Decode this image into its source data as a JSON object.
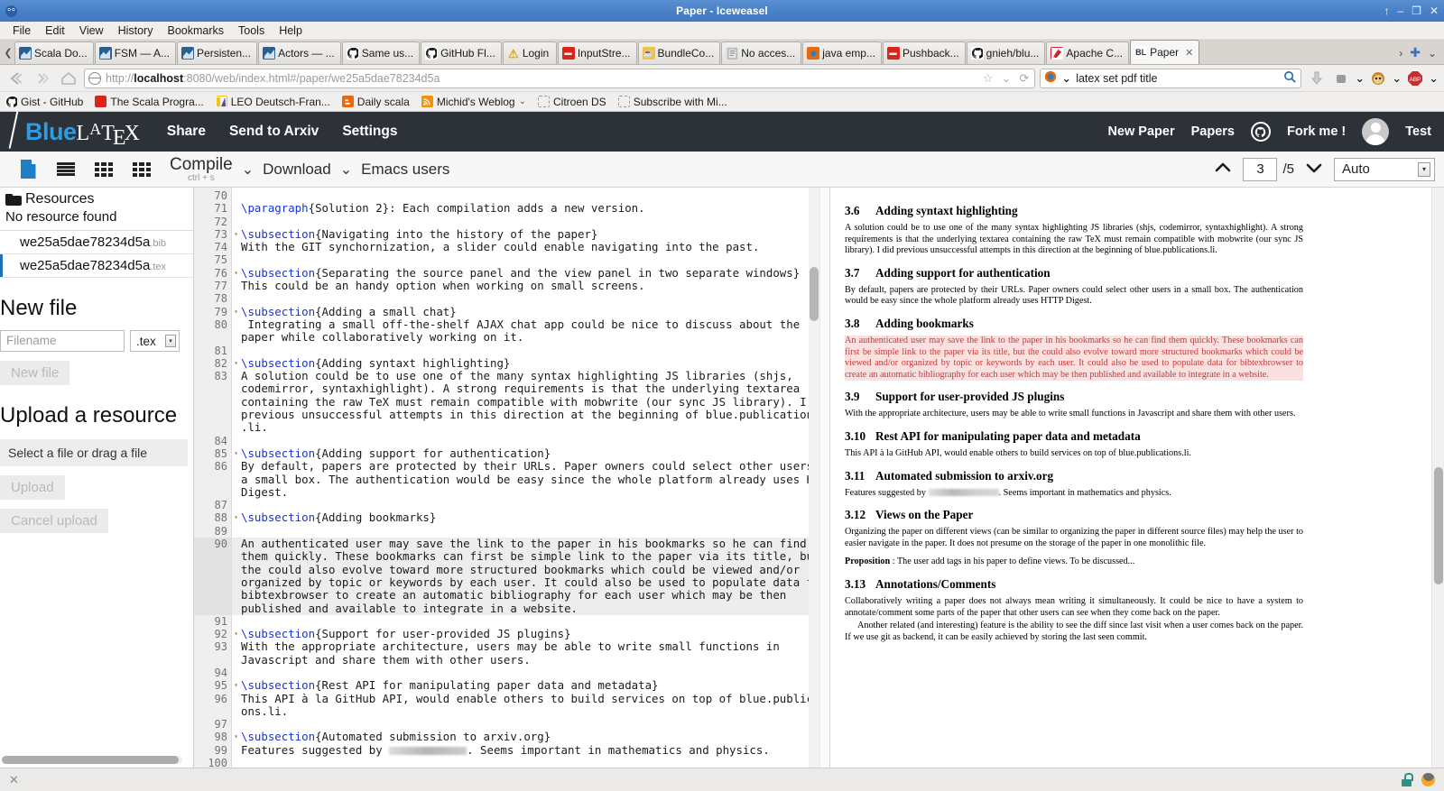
{
  "window": {
    "title": "Paper - Iceweasel",
    "buttons": [
      "↑",
      "–",
      "❐",
      "✕"
    ]
  },
  "menubar": [
    "File",
    "Edit",
    "View",
    "History",
    "Bookmarks",
    "Tools",
    "Help"
  ],
  "tabs": [
    {
      "label": "Scala Do...",
      "icon": "scala-icon",
      "kind": "scala",
      "active": false
    },
    {
      "label": "FSM — A...",
      "icon": "scala-icon",
      "kind": "scala",
      "active": false
    },
    {
      "label": "Persisten...",
      "icon": "scala-icon",
      "kind": "scala",
      "active": false
    },
    {
      "label": "Actors — ...",
      "icon": "scala-icon",
      "kind": "scala",
      "active": false
    },
    {
      "label": "Same us...",
      "icon": "github-icon",
      "kind": "github",
      "active": false
    },
    {
      "label": "GitHub Fl...",
      "icon": "github-icon",
      "kind": "github",
      "active": false
    },
    {
      "label": "Login",
      "icon": "warning-icon",
      "kind": "warn",
      "active": false
    },
    {
      "label": "InputStre...",
      "icon": "stackoverflow-icon",
      "kind": "red",
      "active": false
    },
    {
      "label": "BundleCo...",
      "icon": "bundle-icon",
      "kind": "bundle",
      "active": false
    },
    {
      "label": "No acces...",
      "icon": "document-icon",
      "kind": "doc",
      "active": false
    },
    {
      "label": "java emp...",
      "icon": "firefox-icon",
      "kind": "ff",
      "active": false
    },
    {
      "label": "Pushback...",
      "icon": "stackoverflow-icon",
      "kind": "red",
      "active": false
    },
    {
      "label": "gnieh/blu...",
      "icon": "github-icon",
      "kind": "github",
      "active": false
    },
    {
      "label": "Apache C...",
      "icon": "apache-icon",
      "kind": "apache",
      "active": false
    },
    {
      "label": "Paper",
      "icon": "bluelatex-icon",
      "kind": "bl",
      "active": true
    }
  ],
  "tab_close_label": "✕",
  "tab_overflow_label": "›",
  "tab_new_label": "✚",
  "tab_list_label": "⌄",
  "navbar": {
    "back_icon": "back-arrow-icon",
    "forward_icon": "forward-arrow-icon",
    "home_icon": "home-icon",
    "url": "http://localhost:8080/web/index.html#/paper/we25a5dae78234d5a",
    "url_host": "localhost",
    "url_prefix": "http://",
    "url_suffix": ":8080/web/index.html#/paper/we25a5dae78234d5a",
    "bookmark_star": "☆",
    "reload_icon": "reload-icon",
    "search_query": "latex set pdf title",
    "search_engine_icon": "firefox-icon",
    "search_go_icon": "search-icon",
    "downloads_icon": "download-arrow-icon",
    "extensions_icon": "puzzle-icon",
    "account_icon": "monkey-icon",
    "adblock_icon": "adblock-icon"
  },
  "bookmarks": [
    {
      "label": "Gist - GitHub",
      "icon": "github-icon",
      "kind": "github"
    },
    {
      "label": "The Scala Progra...",
      "icon": "scala-icon",
      "kind": "scalared"
    },
    {
      "label": "LEO Deutsch-Fran...",
      "icon": "leo-icon",
      "kind": "leo"
    },
    {
      "label": "Daily scala",
      "icon": "blogger-icon",
      "kind": "blogger"
    },
    {
      "label": "Michid's Weblog",
      "icon": "rss-icon",
      "kind": "rss",
      "chevron": "⌄"
    },
    {
      "label": "Citroen DS",
      "icon": "placeholder-icon",
      "kind": "dashed"
    },
    {
      "label": "Subscribe with Mi...",
      "icon": "placeholder-icon",
      "kind": "dashed"
    }
  ],
  "app": {
    "logo": {
      "blue": "Blue",
      "l": "L",
      "a": "A",
      "t": "T",
      "e": "E",
      "x": "X"
    },
    "nav": [
      "Share",
      "Send to Arxiv",
      "Settings"
    ],
    "right_nav": [
      "New Paper",
      "Papers"
    ],
    "github_icon": "github-icon",
    "fork_label": "Fork me !",
    "avatar_icon": "avatar-icon",
    "user": "Test"
  },
  "toolbar": {
    "icons": [
      "document-icon",
      "rows-icon",
      "grid-icon",
      "grid-large-icon"
    ],
    "compile_label": "Compile",
    "compile_shortcut": "ctrl + s",
    "chevron": "⌄",
    "download_label": "Download",
    "emacs_label": "Emacs users",
    "page_up_icon": "chevron-up-icon",
    "page_current": "3",
    "page_total": "/5",
    "page_down_icon": "chevron-down-icon",
    "zoom_value": "Auto",
    "zoom_arrow": "▾"
  },
  "sidebar": {
    "resources_title": "Resources",
    "resources_empty": "No resource found",
    "files": [
      {
        "name": "we25a5dae78234d5a",
        "ext": ".bib",
        "active": false
      },
      {
        "name": "we25a5dae78234d5a",
        "ext": ".tex",
        "active": true
      }
    ],
    "new_file_title": "New file",
    "filename_placeholder": "Filename",
    "ext_value": ".tex",
    "new_file_button": "New file",
    "upload_title": "Upload a resource",
    "dropzone_label": "Select a file or drag a file",
    "upload_button": "Upload",
    "cancel_button": "Cancel upload"
  },
  "editor": {
    "lines": [
      {
        "n": "70",
        "fold": false,
        "hl": false,
        "segs": [
          {
            "t": "",
            "c": false
          }
        ]
      },
      {
        "n": "71",
        "fold": false,
        "hl": false,
        "segs": [
          {
            "t": "\\paragraph",
            "c": true
          },
          {
            "t": "{Solution 2}: Each compilation adds a new version.",
            "c": false
          }
        ]
      },
      {
        "n": "72",
        "fold": false,
        "hl": false,
        "segs": [
          {
            "t": "",
            "c": false
          }
        ]
      },
      {
        "n": "73",
        "fold": true,
        "hl": false,
        "segs": [
          {
            "t": "\\subsection",
            "c": true
          },
          {
            "t": "{Navigating into the history of the paper}",
            "c": false
          }
        ]
      },
      {
        "n": "74",
        "fold": false,
        "hl": false,
        "segs": [
          {
            "t": "With the GIT synchornization, a slider could enable navigating into the past.",
            "c": false
          }
        ]
      },
      {
        "n": "75",
        "fold": false,
        "hl": false,
        "segs": [
          {
            "t": "",
            "c": false
          }
        ]
      },
      {
        "n": "76",
        "fold": true,
        "hl": false,
        "segs": [
          {
            "t": "\\subsection",
            "c": true
          },
          {
            "t": "{Separating the source panel and the view panel in two separate windows}",
            "c": false
          }
        ]
      },
      {
        "n": "77",
        "fold": false,
        "hl": false,
        "segs": [
          {
            "t": "This could be an handy option when working on small screens.",
            "c": false
          }
        ]
      },
      {
        "n": "78",
        "fold": false,
        "hl": false,
        "segs": [
          {
            "t": "",
            "c": false
          }
        ]
      },
      {
        "n": "79",
        "fold": true,
        "hl": false,
        "segs": [
          {
            "t": "\\subsection",
            "c": true
          },
          {
            "t": "{Adding a small chat}",
            "c": false
          }
        ]
      },
      {
        "n": "80",
        "fold": false,
        "hl": false,
        "segs": [
          {
            "t": " Integrating a small off-the-shelf AJAX chat app could be nice to discuss about the",
            "c": false
          }
        ]
      },
      {
        "n": "",
        "fold": false,
        "hl": false,
        "segs": [
          {
            "t": "paper while collaboratively working on it.",
            "c": false
          }
        ]
      },
      {
        "n": "81",
        "fold": false,
        "hl": false,
        "segs": [
          {
            "t": "",
            "c": false
          }
        ]
      },
      {
        "n": "82",
        "fold": true,
        "hl": false,
        "segs": [
          {
            "t": "\\subsection",
            "c": true
          },
          {
            "t": "{Adding syntaxt highlighting}",
            "c": false
          }
        ]
      },
      {
        "n": "83",
        "fold": false,
        "hl": false,
        "segs": [
          {
            "t": "A solution could be to use one of the many syntax highlighting JS libraries (shjs,",
            "c": false
          }
        ]
      },
      {
        "n": "",
        "fold": false,
        "hl": false,
        "segs": [
          {
            "t": "codemirror, syntaxhighlight). A strong requirements is that the underlying textarea",
            "c": false
          }
        ]
      },
      {
        "n": "",
        "fold": false,
        "hl": false,
        "segs": [
          {
            "t": "containing the raw TeX must remain compatible with mobwrite (our sync JS library). I did",
            "c": false
          }
        ]
      },
      {
        "n": "",
        "fold": false,
        "hl": false,
        "segs": [
          {
            "t": "previous unsuccessful attempts in this direction at the beginning of blue.publications",
            "c": false
          }
        ]
      },
      {
        "n": "",
        "fold": false,
        "hl": false,
        "segs": [
          {
            "t": ".li.",
            "c": false
          }
        ]
      },
      {
        "n": "84",
        "fold": false,
        "hl": false,
        "segs": [
          {
            "t": "",
            "c": false
          }
        ]
      },
      {
        "n": "85",
        "fold": true,
        "hl": false,
        "segs": [
          {
            "t": "\\subsection",
            "c": true
          },
          {
            "t": "{Adding support for authentication}",
            "c": false
          }
        ]
      },
      {
        "n": "86",
        "fold": false,
        "hl": false,
        "segs": [
          {
            "t": "By default, papers are protected by their URLs. Paper owners could select other users in",
            "c": false
          }
        ]
      },
      {
        "n": "",
        "fold": false,
        "hl": false,
        "segs": [
          {
            "t": "a small box. The authentication would be easy since the whole platform already uses HTTP",
            "c": false
          }
        ]
      },
      {
        "n": "",
        "fold": false,
        "hl": false,
        "segs": [
          {
            "t": "Digest.",
            "c": false
          }
        ]
      },
      {
        "n": "87",
        "fold": false,
        "hl": false,
        "segs": [
          {
            "t": "",
            "c": false
          }
        ]
      },
      {
        "n": "88",
        "fold": true,
        "hl": false,
        "segs": [
          {
            "t": "\\subsection",
            "c": true
          },
          {
            "t": "{Adding bookmarks}",
            "c": false
          }
        ]
      },
      {
        "n": "89",
        "fold": false,
        "hl": false,
        "segs": [
          {
            "t": "",
            "c": false
          }
        ]
      },
      {
        "n": "90",
        "fold": false,
        "hl": true,
        "segs": [
          {
            "t": "An authenticated user may save the link to the paper in his bookmarks so he can find",
            "c": false
          }
        ]
      },
      {
        "n": "",
        "fold": false,
        "hl": true,
        "segs": [
          {
            "t": "them quickly. These bookmarks can first be simple link to the paper via its title, but",
            "c": false
          }
        ]
      },
      {
        "n": "",
        "fold": false,
        "hl": true,
        "segs": [
          {
            "t": "the could also evolve toward more structured bookmarks which could be viewed and/or",
            "c": false
          }
        ]
      },
      {
        "n": "",
        "fold": false,
        "hl": true,
        "segs": [
          {
            "t": "organized by topic or keywords by each user. It could also be used to populate data for",
            "c": false
          }
        ]
      },
      {
        "n": "",
        "fold": false,
        "hl": true,
        "segs": [
          {
            "t": "bibtexbrowser to create an automatic bibliography for each user which may be then",
            "c": false
          }
        ]
      },
      {
        "n": "",
        "fold": false,
        "hl": true,
        "segs": [
          {
            "t": "published and available to integrate in a website.",
            "c": false
          }
        ]
      },
      {
        "n": "91",
        "fold": false,
        "hl": false,
        "segs": [
          {
            "t": "",
            "c": false
          }
        ]
      },
      {
        "n": "92",
        "fold": true,
        "hl": false,
        "segs": [
          {
            "t": "\\subsection",
            "c": true
          },
          {
            "t": "{Support for user-provided JS plugins}",
            "c": false
          }
        ]
      },
      {
        "n": "93",
        "fold": false,
        "hl": false,
        "segs": [
          {
            "t": "With the appropriate architecture, users may be able to write small functions in",
            "c": false
          }
        ]
      },
      {
        "n": "",
        "fold": false,
        "hl": false,
        "segs": [
          {
            "t": "Javascript and share them with other users.",
            "c": false
          }
        ]
      },
      {
        "n": "94",
        "fold": false,
        "hl": false,
        "segs": [
          {
            "t": "",
            "c": false
          }
        ]
      },
      {
        "n": "95",
        "fold": true,
        "hl": false,
        "segs": [
          {
            "t": "\\subsection",
            "c": true
          },
          {
            "t": "{Rest API for manipulating paper data and metadata}",
            "c": false
          }
        ]
      },
      {
        "n": "96",
        "fold": false,
        "hl": false,
        "segs": [
          {
            "t": "This API à la GitHub API, would enable others to build services on top of blue.publicati",
            "c": false
          }
        ]
      },
      {
        "n": "",
        "fold": false,
        "hl": false,
        "segs": [
          {
            "t": "ons.li.",
            "c": false
          }
        ]
      },
      {
        "n": "97",
        "fold": false,
        "hl": false,
        "segs": [
          {
            "t": "",
            "c": false
          }
        ]
      },
      {
        "n": "98",
        "fold": true,
        "hl": false,
        "segs": [
          {
            "t": "\\subsection",
            "c": true
          },
          {
            "t": "{Automated submission to arxiv.org}",
            "c": false
          }
        ]
      },
      {
        "n": "99",
        "fold": false,
        "hl": false,
        "segs": [
          {
            "t": "Features suggested by ██████████. Seems important in mathematics and physics.",
            "c": false
          }
        ]
      },
      {
        "n": "100",
        "fold": false,
        "hl": false,
        "segs": [
          {
            "t": "",
            "c": false
          }
        ]
      }
    ]
  },
  "preview": {
    "blocks": [
      {
        "type": "h",
        "num": "3.6",
        "text": "Adding syntaxt highlighting"
      },
      {
        "type": "p",
        "hl": false,
        "text": "A solution could be to use one of the many syntax highlighting JS libraries (shjs, codemirror, syntaxhighlight). A strong requirements is that the underlying textarea containing the raw TeX must remain compatible with mobwrite (our sync JS library). I did previous unsuccessful attempts in this direction at the beginning of blue.publications.li."
      },
      {
        "type": "h",
        "num": "3.7",
        "text": "Adding support for authentication"
      },
      {
        "type": "p",
        "hl": false,
        "text": "By default, papers are protected by their URLs. Paper owners could select other users in a small box. The authentication would be easy since the whole platform already uses HTTP Digest."
      },
      {
        "type": "h",
        "num": "3.8",
        "text": "Adding bookmarks"
      },
      {
        "type": "p",
        "hl": true,
        "text": "An authenticated user may save the link to the paper in his bookmarks so he can find them quickly. These bookmarks can first be simple link to the paper via its title, but the could also evolve toward more structured bookmarks which could be viewed and/or organized by topic or keywords by each user. It could also be used to populate data for bibtexbrowser to create an automatic bibliography for each user which may be then published and available to integrate in a website."
      },
      {
        "type": "h",
        "num": "3.9",
        "text": "Support for user-provided JS plugins"
      },
      {
        "type": "p",
        "hl": false,
        "text": "With the appropriate architecture, users may be able to write small functions in Javascript and share them with other users."
      },
      {
        "type": "h",
        "num": "3.10",
        "text": "Rest API for manipulating paper data and metadata"
      },
      {
        "type": "p",
        "hl": false,
        "text": "This API à la GitHub API, would enable others to build services on top of blue.publications.li."
      },
      {
        "type": "h",
        "num": "3.11",
        "text": "Automated submission to arxiv.org"
      },
      {
        "type": "redacted",
        "hl": false,
        "pre": "Features suggested by ",
        "post": ". Seems important in mathematics and physics."
      },
      {
        "type": "h",
        "num": "3.12",
        "text": "Views on the Paper"
      },
      {
        "type": "p",
        "hl": false,
        "text": "Organizing the paper on different views (can be similar to organizing the paper in different source files) may help the user to easier navigate in the paper. It does not presume on the storage of the paper in one monolithic file."
      },
      {
        "type": "prop",
        "hl": false,
        "label": "Proposition",
        "text": " : The user add tags in his paper to define views. To be discussed..."
      },
      {
        "type": "h",
        "num": "3.13",
        "text": "Annotations/Comments"
      },
      {
        "type": "p",
        "hl": false,
        "text": "Collaboratively writing a paper does not always mean writing it simultaneously. It could be nice to have a system to annotate/comment some parts of the paper that other users can see when they come back on the paper."
      },
      {
        "type": "p2",
        "hl": false,
        "text": "Another related (and interesting) feature is the ability to see the diff since last visit when a user comes back on the paper. If we use git as backend, it can be easily achieved by storing the last seen commit."
      }
    ]
  },
  "statusbar": {
    "close_label": "✕",
    "lock_icon": "lock-icon",
    "firefox_icon": "firefox-icon"
  }
}
